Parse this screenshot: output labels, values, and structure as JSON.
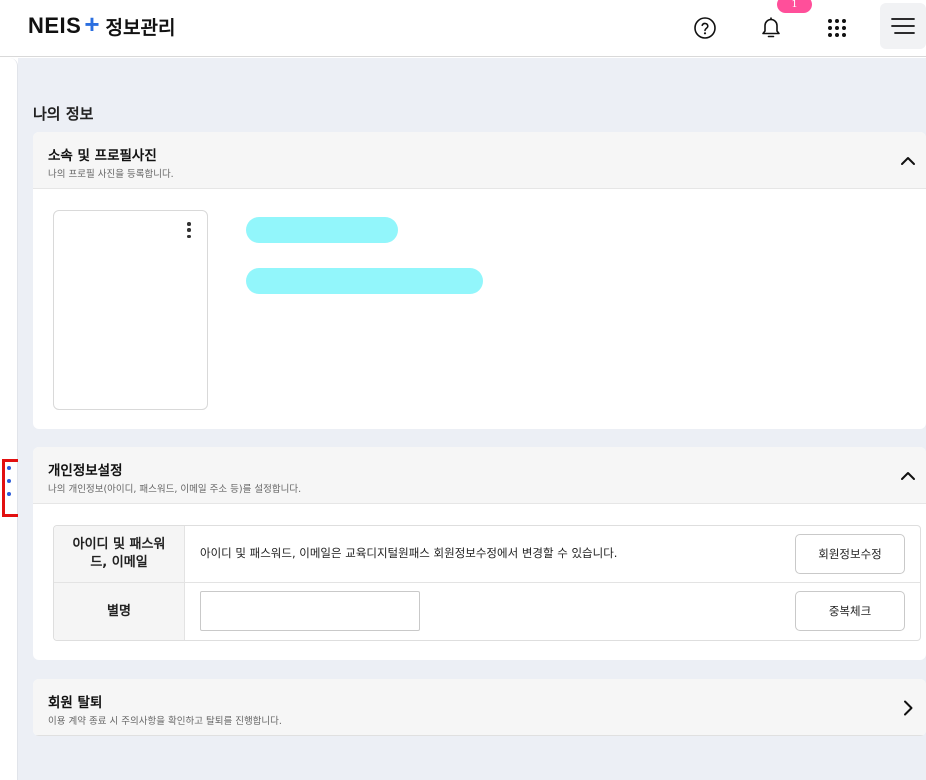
{
  "header": {
    "brand": "NEIS",
    "plus": "+",
    "title": "정보관리",
    "notification_count": "1"
  },
  "page": {
    "title": "나의 정보"
  },
  "sections": {
    "profile": {
      "title": "소속 및 프로필사진",
      "subtitle": "나의 프로필 사진을 등록합니다."
    },
    "personal": {
      "title": "개인정보설정",
      "subtitle": "나의 개인정보(아이디, 패스워드, 이메일 주소 등)를 설정합니다.",
      "rows": [
        {
          "label": "아이디 및 패스워드, 이메일",
          "text": "아이디 및 패스워드, 이메일은 교육디지털원패스 회원정보수정에서 변경할 수 있습니다.",
          "button": "회원정보수정"
        },
        {
          "label": "별명",
          "input_value": "",
          "button": "중복체크"
        }
      ]
    },
    "withdraw": {
      "title": "회원 탈퇴",
      "subtitle": "이용 계약 종료 시 주의사항을 확인하고 탈퇴를 진행합니다."
    }
  },
  "colors": {
    "accent": "#2b6fe0",
    "badge": "#ff4f9a",
    "skeleton": "#92f6fb",
    "highlight": "#e21010",
    "background": "#eceff5"
  },
  "icons": [
    "help-icon",
    "bell-icon",
    "apps-grid-icon",
    "hamburger-menu-icon",
    "chevron-up-icon",
    "chevron-right-icon",
    "kebab-icon",
    "drag-handle-icon"
  ]
}
